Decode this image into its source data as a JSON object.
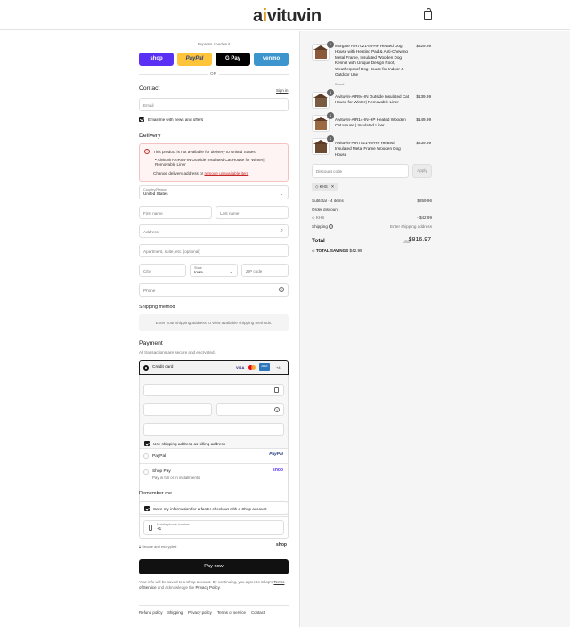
{
  "header": {
    "logo_prefix": "a",
    "logo_i": "i",
    "logo_rest": "vituvin",
    "bag_icon": "shopping-bag-icon"
  },
  "express": {
    "title": "Express checkout",
    "buttons": [
      {
        "label": "shop",
        "color": "#5a31f4"
      },
      {
        "label": "PayPal",
        "color": "#ffc439"
      },
      {
        "label": "G Pay",
        "color": "#000000"
      },
      {
        "label": "venmo",
        "color": "#3d95ce"
      }
    ],
    "or": "OR"
  },
  "contact": {
    "heading": "Contact",
    "sign_in": "Sign in",
    "email_placeholder": "Email",
    "news_label": "Email me with news and offers"
  },
  "delivery": {
    "heading": "Delivery",
    "error_title": "This product is not available for delivery to United States.",
    "error_item": "Aivituvin-AIR94-IN Outside Insulated Cat House for Winter| Removable Liner",
    "error_change": "Change delivery address or",
    "error_remove": "remove unavailable item",
    "country_label": "Country/Region",
    "country_value": "United States",
    "first_name": "First name",
    "last_name": "Last name",
    "address": "Address",
    "apartment": "Apartment, suite, etc. (optional)",
    "city": "City",
    "state_label": "State",
    "state_value": "Iowa",
    "zip": "ZIP code",
    "phone": "Phone"
  },
  "shipping": {
    "heading": "Shipping method",
    "note": "Enter your shipping address to view available shipping methods."
  },
  "payment": {
    "heading": "Payment",
    "subtitle": "All transactions are secure and encrypted.",
    "credit_card": "Credit card",
    "cards": [
      "VISA",
      "MC",
      "AMEX",
      "+4"
    ],
    "billing_label": "Use shipping address as billing address",
    "paypal": "PayPal",
    "paypal_logo": "PayPal",
    "shoppay": "Shop Pay",
    "shoppay_sub": "Pay in full or in installments",
    "shoppay_logo": "shop"
  },
  "remember": {
    "heading": "Remember me",
    "save_label": "Save my information for a faster checkout with a Shop account",
    "mobile_label": "Mobile phone number",
    "mobile_value": "+1",
    "secure": "Secure and encrypted",
    "shop_logo": "shop"
  },
  "pay_now": "Pay now",
  "legal": {
    "text1": "Your info will be saved to a Shop account. By continuing, you agree to Shop's",
    "terms": "Terms of Service",
    "text2": "and acknowledge the",
    "privacy": "Privacy Policy",
    "text3": "."
  },
  "footer_links": [
    "Refund policy",
    "Shipping",
    "Privacy policy",
    "Terms of service",
    "Contact"
  ],
  "order": {
    "items": [
      {
        "qty": "1",
        "name": "Morgate AIR7021-IN-HP Heated Dog House with Heating Pad & Anti-Chewing Metal Frame, Insulated Wooden Dog Kennel with Unique Design Roof, Weatherproof Dog House for Indoor & Outdoor Use",
        "variant": "Wood",
        "price": "$329.99"
      },
      {
        "qty": "1",
        "name": "Aivituvin-AIR94-IN Outside Insulated Cat House for Winter| Removable Liner",
        "variant": "",
        "price": "$139.99"
      },
      {
        "qty": "1",
        "name": "Aivituvin-AIR14-IN-HP Heated Wooden Cat House | Insulated Liner",
        "variant": "",
        "price": "$149.99"
      },
      {
        "qty": "1",
        "name": "Aivituvin-AIR7021-IN-HP Heated Insulated Metal Frame Wooden Dog House",
        "variant": "",
        "price": "$239.99"
      }
    ],
    "discount_placeholder": "Discount code",
    "apply": "Apply",
    "tag": "KHS",
    "subtotal_label": "Subtotal · 4 items",
    "subtotal": "$859.96",
    "order_discount": "Order discount",
    "discount_code": "KHS",
    "discount_value": "- $42.99",
    "shipping_label": "Shipping",
    "shipping_value": "Enter shipping address",
    "total_label": "Total",
    "currency": "USD",
    "total": "$816.97",
    "savings_label": "TOTAL SAVINGS",
    "savings": "$42.99"
  }
}
